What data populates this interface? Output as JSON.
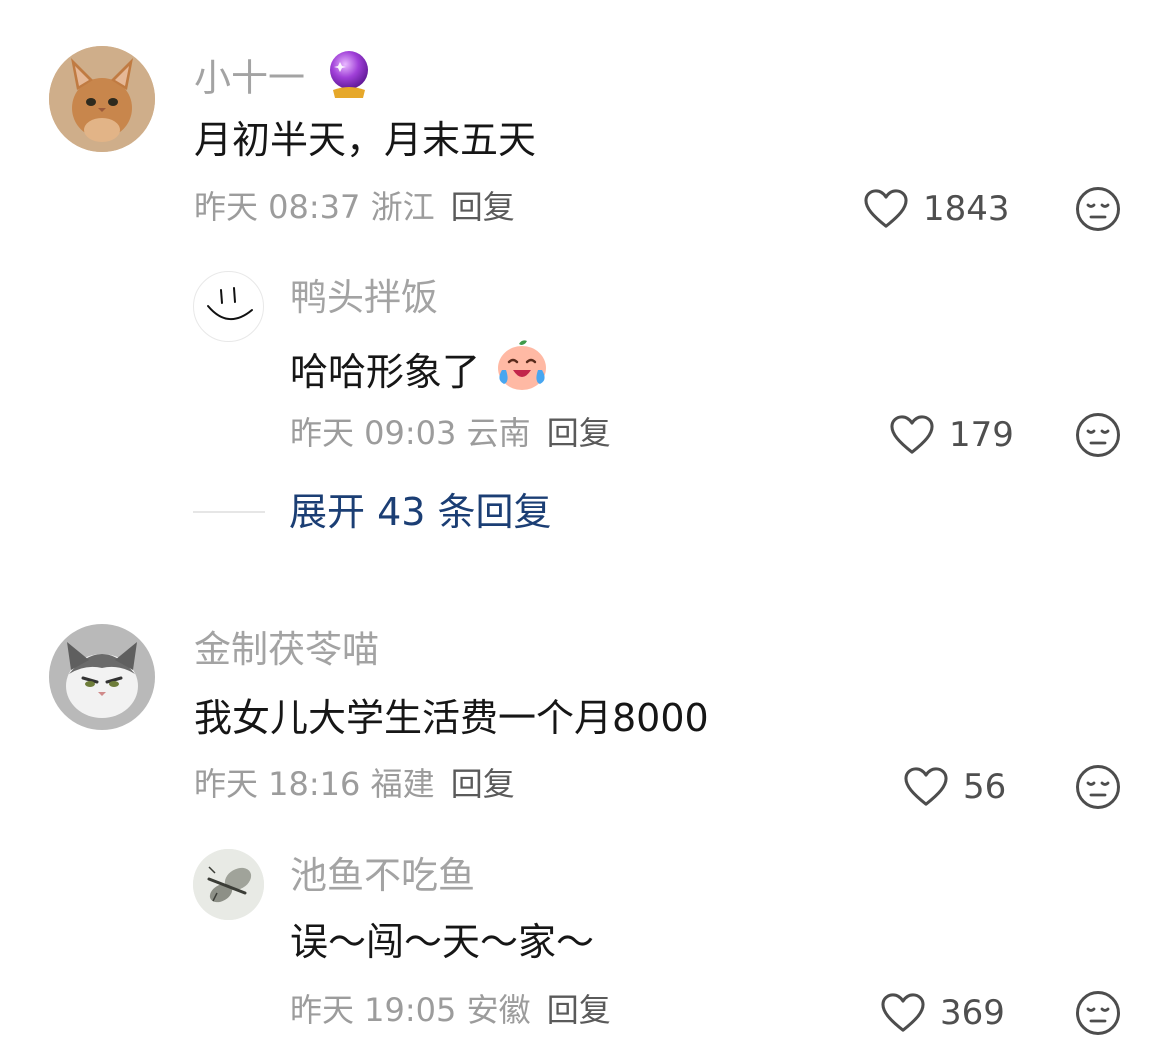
{
  "comments": [
    {
      "name": "小十一",
      "name_badge": "crystal-ball-emoji",
      "text": "月初半天，月末五天",
      "time": "昨天 08:37",
      "location": "浙江",
      "reply_label": "回复",
      "likes": "1843",
      "replies": [
        {
          "name": "鸭头拌饭",
          "text": "哈哈形象了",
          "text_emoji": "laughing-crying-face",
          "time": "昨天 09:03",
          "location": "云南",
          "reply_label": "回复",
          "likes": "179"
        }
      ],
      "expand_label": "展开 43 条回复"
    },
    {
      "name": "金制茯苓喵",
      "text": "我女儿大学生活费一个月8000",
      "time": "昨天 18:16",
      "location": "福建",
      "reply_label": "回复",
      "likes": "56",
      "replies": [
        {
          "name": "池鱼不吃鱼",
          "text": "误～闯～天～家～",
          "time": "昨天 19:05",
          "location": "安徽",
          "reply_label": "回复",
          "likes": "369"
        }
      ]
    }
  ],
  "colors": {
    "name": "#a3a3a3",
    "text": "#161616",
    "meta": "#9c9c9c",
    "expand_link": "#1b3e74"
  }
}
